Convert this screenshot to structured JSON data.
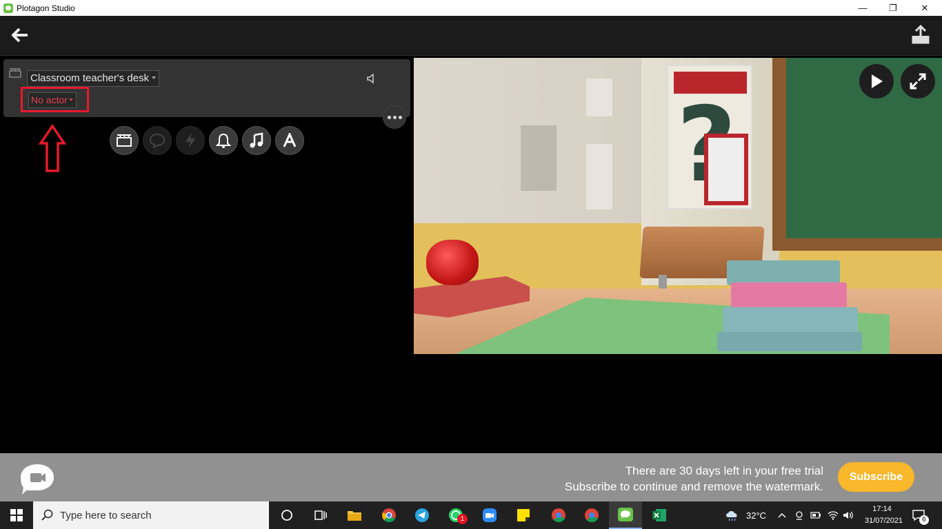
{
  "window": {
    "title": "Plotagon Studio"
  },
  "scene": {
    "location": "Classroom teacher's desk",
    "actor": "No actor"
  },
  "trial": {
    "line1": "There are 30 days left in your free trial",
    "line2": "Subscribe to continue and remove the watermark.",
    "subscribe_label": "Subscribe"
  },
  "taskbar": {
    "search_placeholder": "Type here to search",
    "whatsapp_badge": "1",
    "weather": "32°C",
    "time": "17:14",
    "date": "31/07/2021",
    "notifications": "6"
  },
  "colors": {
    "highlight": "#e8192c",
    "subscribe": "#f9b72c",
    "accent_green": "#6cc24a"
  }
}
